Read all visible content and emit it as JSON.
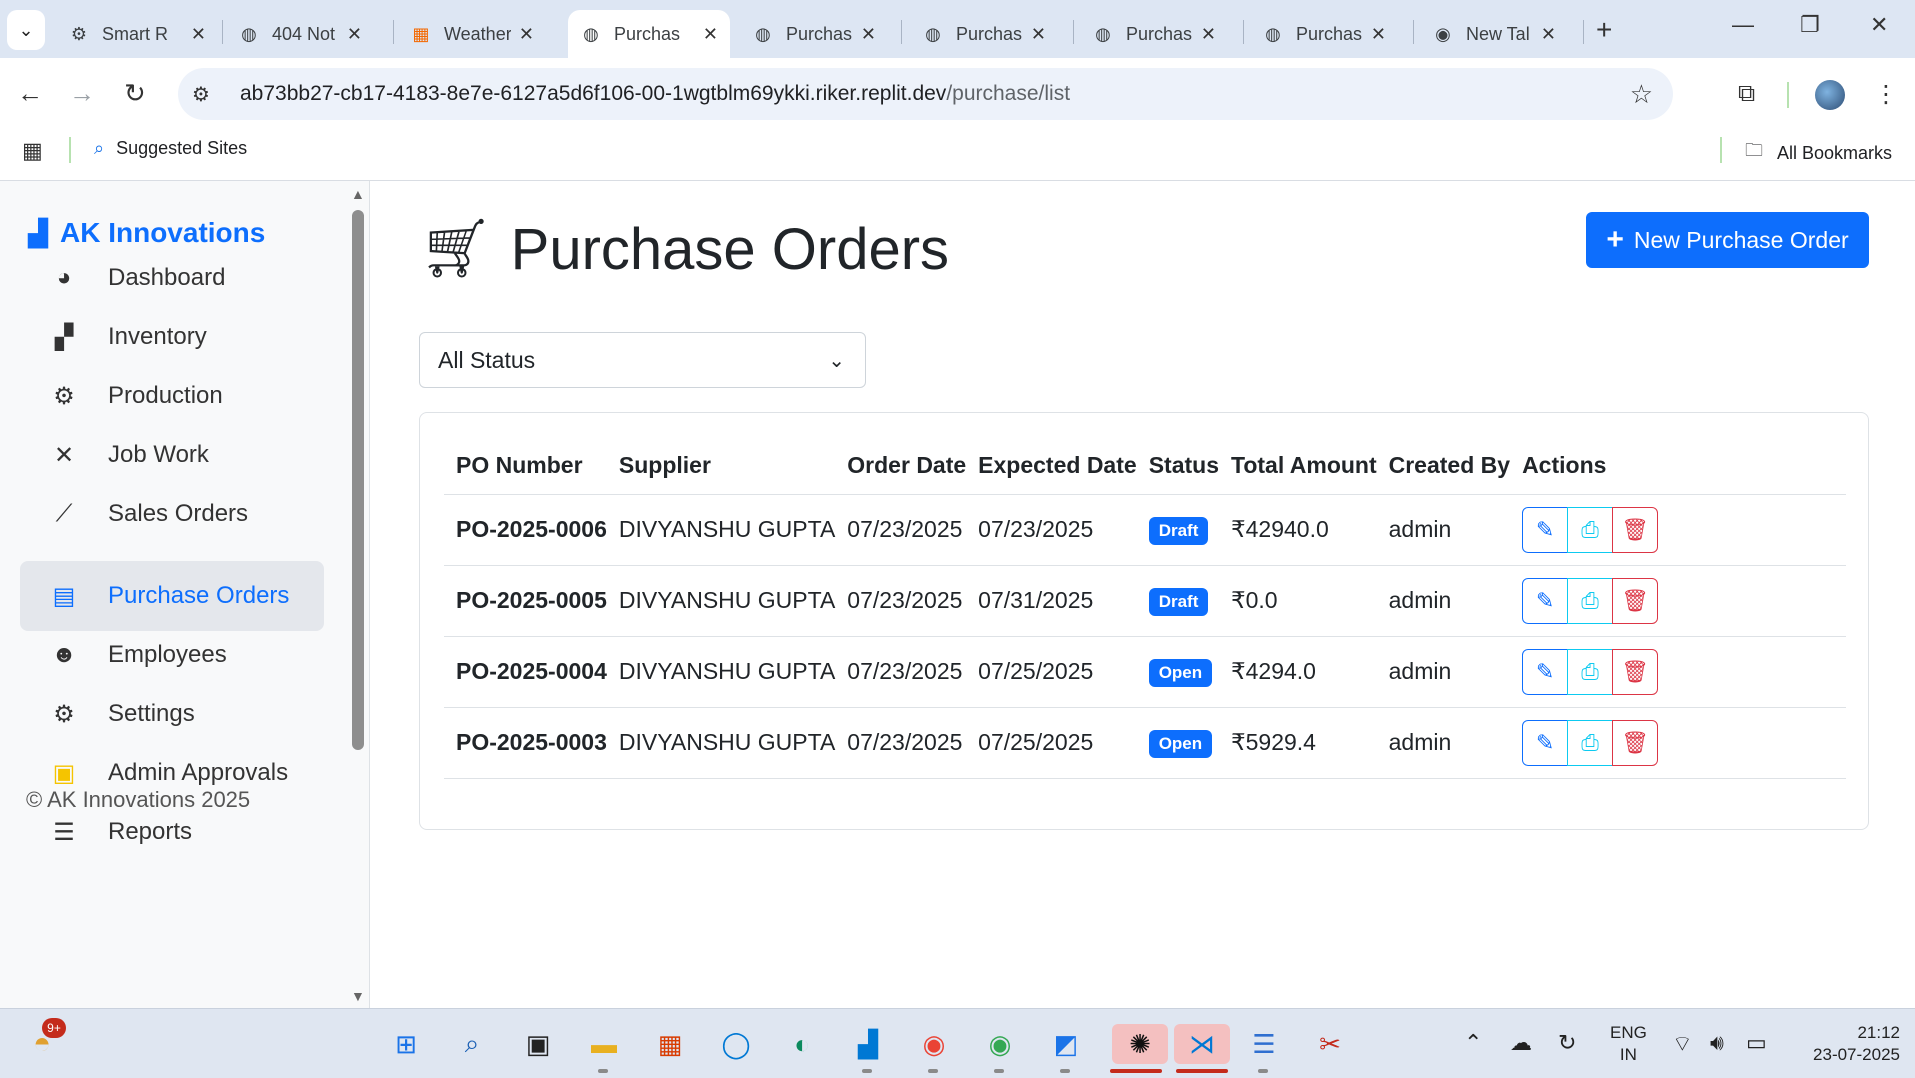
{
  "browser": {
    "tabs": [
      {
        "title": "Smart R",
        "icon": "openai-icon",
        "active": false
      },
      {
        "title": "404 Not",
        "icon": "globe-icon",
        "active": false
      },
      {
        "title": "Weather",
        "icon": "grafana-icon",
        "active": false
      },
      {
        "title": "Purchas",
        "icon": "globe-icon",
        "active": true
      },
      {
        "title": "Purchas",
        "icon": "globe-icon",
        "active": false
      },
      {
        "title": "Purchas",
        "icon": "globe-icon",
        "active": false
      },
      {
        "title": "Purchas",
        "icon": "globe-icon",
        "active": false
      },
      {
        "title": "Purchas",
        "icon": "globe-icon",
        "active": false
      },
      {
        "title": "New Tal",
        "icon": "chrome-icon",
        "active": false
      }
    ],
    "url_main": "ab73bb27-cb17-4183-8e7e-6127a5d6f106-00-1wgtblm69ykki.riker.replit.dev",
    "url_path": "/purchase/list",
    "bookmarks": {
      "suggested": "Suggested Sites",
      "all": "All Bookmarks"
    }
  },
  "sidebar": {
    "brand": "AK Innovations",
    "items": [
      {
        "label": "Dashboard",
        "icon": "palette-icon"
      },
      {
        "label": "Inventory",
        "icon": "boxes-icon"
      },
      {
        "label": "Production",
        "icon": "cogs-icon"
      },
      {
        "label": "Job Work",
        "icon": "tools-icon"
      },
      {
        "label": "Sales Orders",
        "icon": "chart-line-icon"
      },
      {
        "label": "Purchase Orders",
        "icon": "file-invoice-icon"
      },
      {
        "label": "Employees",
        "icon": "users-icon"
      },
      {
        "label": "Settings",
        "icon": "gear-icon"
      },
      {
        "label": "Admin Approvals",
        "icon": "clipboard-check-icon"
      },
      {
        "label": "Reports",
        "icon": "list-icon"
      }
    ],
    "copyright": "© AK Innovations 2025"
  },
  "main": {
    "title": "Purchase Orders",
    "new_button": "New Purchase Order",
    "status_filter": "All Status",
    "table": {
      "headers": [
        "PO Number",
        "Supplier",
        "Order Date",
        "Expected Date",
        "Status",
        "Total Amount",
        "Created By",
        "Actions"
      ],
      "rows": [
        {
          "po": "PO-2025-0006",
          "supplier": "DIVYANSHU GUPTA",
          "order_date": "07/23/2025",
          "expected": "07/23/2025",
          "status": "Draft",
          "total": "₹42940.0",
          "created_by": "admin"
        },
        {
          "po": "PO-2025-0005",
          "supplier": "DIVYANSHU GUPTA",
          "order_date": "07/23/2025",
          "expected": "07/31/2025",
          "status": "Draft",
          "total": "₹0.0",
          "created_by": "admin"
        },
        {
          "po": "PO-2025-0004",
          "supplier": "DIVYANSHU GUPTA",
          "order_date": "07/23/2025",
          "expected": "07/25/2025",
          "status": "Open",
          "total": "₹4294.0",
          "created_by": "admin"
        },
        {
          "po": "PO-2025-0003",
          "supplier": "DIVYANSHU GUPTA",
          "order_date": "07/23/2025",
          "expected": "07/25/2025",
          "status": "Open",
          "total": "₹5929.4",
          "created_by": "admin"
        }
      ]
    }
  },
  "taskbar": {
    "notification_count": "9+",
    "lang_top": "ENG",
    "lang_bottom": "IN",
    "time": "21:12",
    "date": "23-07-2025"
  },
  "colors": {
    "primary": "#0d6efd",
    "info": "#0dcaf0",
    "danger": "#dc3545",
    "sidebar_bg": "#f8f9fa"
  }
}
